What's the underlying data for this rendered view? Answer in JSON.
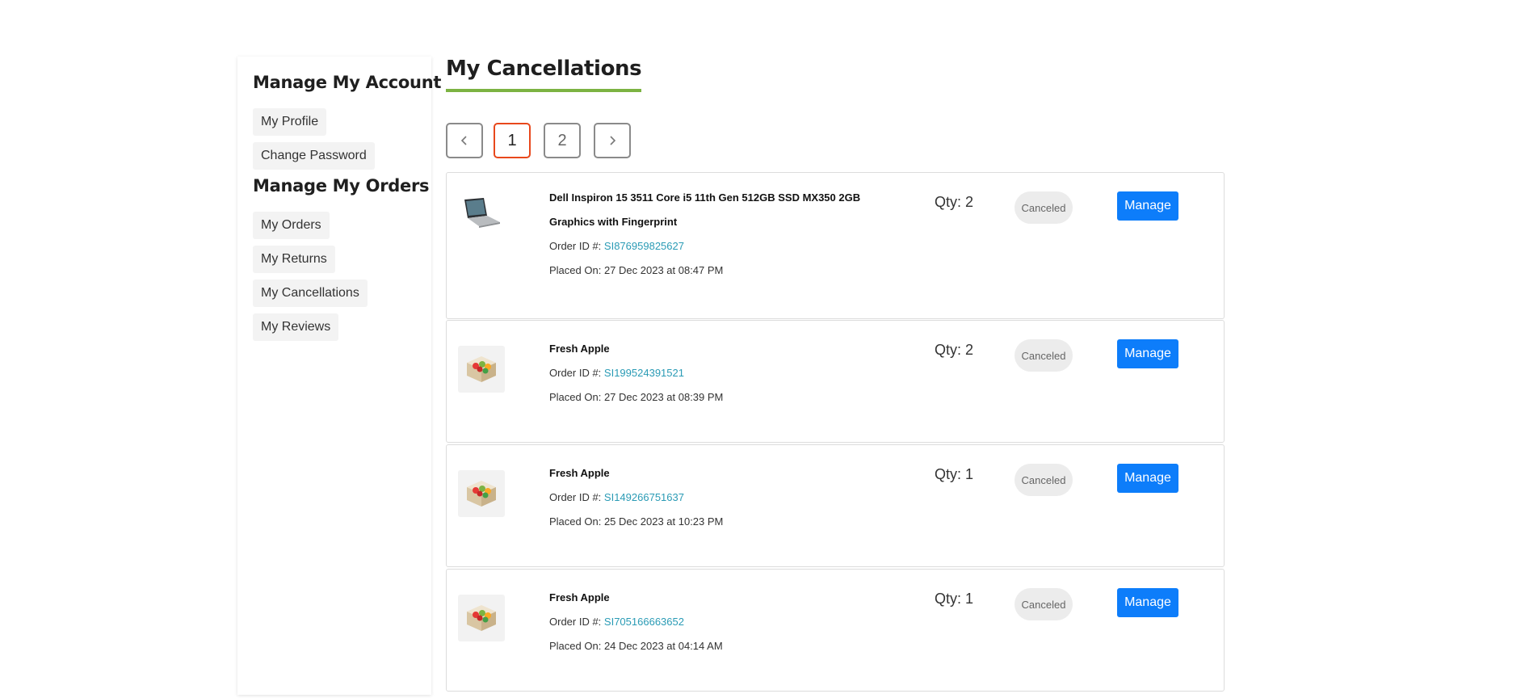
{
  "sidebar": {
    "account_heading": "Manage My Account",
    "account_items": [
      {
        "label": "My Profile"
      },
      {
        "label": "Change Password"
      }
    ],
    "orders_heading": "Manage My Orders",
    "orders_items": [
      {
        "label": "My Orders"
      },
      {
        "label": "My Returns"
      },
      {
        "label": "My Cancellations"
      },
      {
        "label": "My Reviews"
      }
    ]
  },
  "main": {
    "title": "My Cancellations",
    "pagination": {
      "prev_icon": "chevron-left-icon",
      "pages": [
        "1",
        "2"
      ],
      "current_page": "1",
      "next_icon": "chevron-right-icon"
    },
    "order_id_label": "Order ID #:",
    "placed_on_label": "Placed On:",
    "orders": [
      {
        "name": "Dell Inspiron 15 3511 Core i5 11th Gen 512GB SSD MX350 2GB Graphics with Fingerprint",
        "order_id": "SI876959825627",
        "placed_on": "27 Dec 2023 at 08:47 PM",
        "qty": "Qty: 2",
        "status": "Canceled",
        "action": "Manage",
        "thumb_icon": "laptop-icon"
      },
      {
        "name": "Fresh Apple",
        "order_id": "SI199524391521",
        "placed_on": "27 Dec 2023 at 08:39 PM",
        "qty": "Qty: 2",
        "status": "Canceled",
        "action": "Manage",
        "thumb_icon": "fruit-box-icon"
      },
      {
        "name": "Fresh Apple",
        "order_id": "SI149266751637",
        "placed_on": "25 Dec 2023 at 10:23 PM",
        "qty": "Qty: 1",
        "status": "Canceled",
        "action": "Manage",
        "thumb_icon": "fruit-box-icon"
      },
      {
        "name": "Fresh Apple",
        "order_id": "SI705166663652",
        "placed_on": "24 Dec 2023 at 04:14 AM",
        "qty": "Qty: 1",
        "status": "Canceled",
        "action": "Manage",
        "thumb_icon": "fruit-box-icon"
      }
    ]
  },
  "colors": {
    "accent_underline": "#7cb342",
    "active_page_border": "#e8481c",
    "manage_button": "#0d7dfa",
    "order_id_link": "#2a9bb5"
  }
}
